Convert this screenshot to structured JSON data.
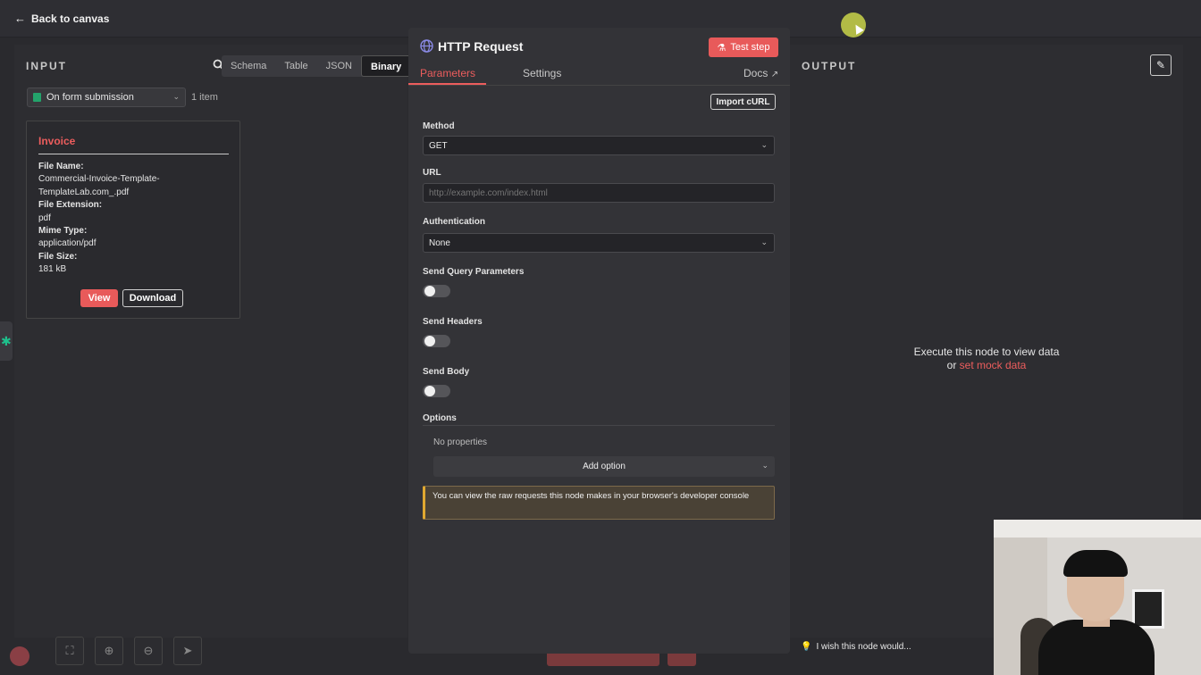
{
  "topbar": {
    "back_label": "Back to canvas"
  },
  "input": {
    "title": "INPUT",
    "tabs": [
      "Schema",
      "Table",
      "JSON",
      "Binary"
    ],
    "active_tab": "Binary",
    "node_select": "On form submission",
    "item_count": "1 item",
    "card": {
      "title": "Invoice",
      "fields": [
        {
          "key": "File Name:",
          "value": "Commercial-Invoice-Template-TemplateLab.com_.pdf"
        },
        {
          "key": "File Extension:",
          "value": "pdf"
        },
        {
          "key": "Mime Type:",
          "value": "application/pdf"
        },
        {
          "key": "File Size:",
          "value": "181 kB"
        }
      ],
      "view_label": "View",
      "download_label": "Download"
    }
  },
  "node": {
    "title": "HTTP Request",
    "test_step_label": "Test step",
    "tabs": {
      "parameters": "Parameters",
      "settings": "Settings"
    },
    "docs_label": "Docs",
    "import_curl_label": "Import cURL",
    "method": {
      "label": "Method",
      "value": "GET"
    },
    "url": {
      "label": "URL",
      "placeholder": "http://example.com/index.html"
    },
    "authentication": {
      "label": "Authentication",
      "value": "None"
    },
    "send_query": {
      "label": "Send Query Parameters",
      "enabled": false
    },
    "send_headers": {
      "label": "Send Headers",
      "enabled": false
    },
    "send_body": {
      "label": "Send Body",
      "enabled": false
    },
    "options": {
      "label": "Options",
      "empty_text": "No properties",
      "add_label": "Add option"
    },
    "notice": "You can view the raw requests this node makes in your browser's developer console"
  },
  "output": {
    "title": "OUTPUT",
    "message_line1": "Execute this node to view data",
    "message_or": "or ",
    "message_link": "set mock data",
    "feedback": "I wish this node would..."
  },
  "colors": {
    "accent": "#ec5d5d",
    "notice_border": "#e0a830",
    "form_icon": "#23a36b"
  }
}
